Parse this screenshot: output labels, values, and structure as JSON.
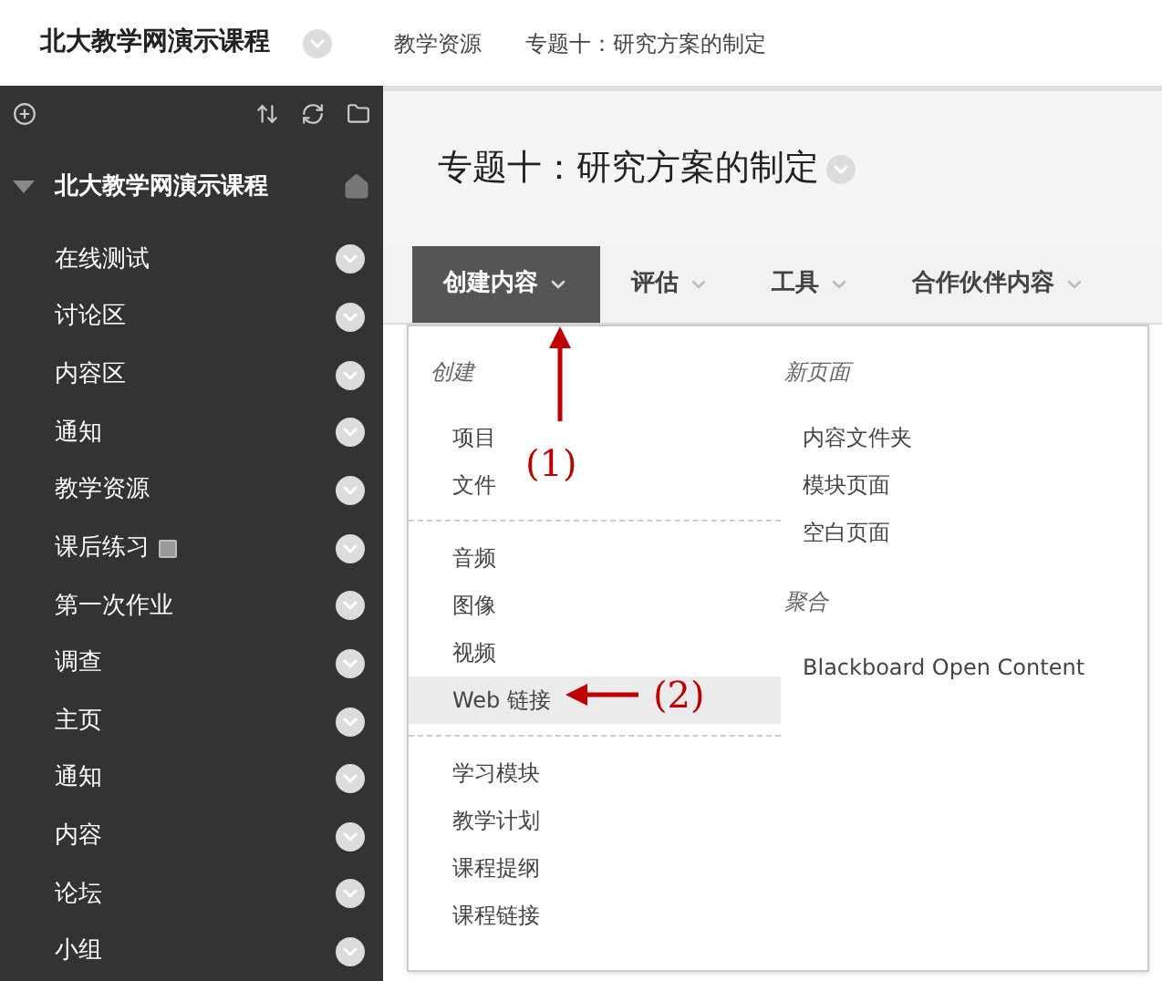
{
  "top_bar": {
    "course_title": "北大教学网演示课程",
    "breadcrumbs": [
      "教学资源",
      "专题十：研究方案的制定"
    ]
  },
  "sidebar": {
    "course_title": "北大教学网演示课程",
    "items": [
      {
        "label": "在线测试",
        "unavailable": false
      },
      {
        "label": "讨论区",
        "unavailable": false
      },
      {
        "label": "内容区",
        "unavailable": false
      },
      {
        "label": "通知",
        "unavailable": false
      },
      {
        "label": "教学资源",
        "unavailable": false
      },
      {
        "label": "课后练习",
        "unavailable": true
      },
      {
        "label": "第一次作业",
        "unavailable": false
      },
      {
        "label": "调查",
        "unavailable": false
      },
      {
        "label": "主页",
        "unavailable": false
      },
      {
        "label": "通知",
        "unavailable": false
      },
      {
        "label": "内容",
        "unavailable": false
      },
      {
        "label": "论坛",
        "unavailable": false
      },
      {
        "label": "小组",
        "unavailable": false
      }
    ]
  },
  "page_title": "专题十：研究方案的制定",
  "tabs": [
    {
      "label": "创建内容",
      "selected": true
    },
    {
      "label": "评估",
      "selected": false
    },
    {
      "label": "工具",
      "selected": false
    },
    {
      "label": "合作伙伴内容",
      "selected": false
    }
  ],
  "menu": {
    "left_groups": [
      {
        "heading": "创建",
        "items": [
          {
            "label": "项目",
            "selected": false
          },
          {
            "label": "文件",
            "selected": false
          }
        ]
      },
      {
        "items": [
          {
            "label": "音频",
            "selected": false
          },
          {
            "label": "图像",
            "selected": false
          },
          {
            "label": "视频",
            "selected": false
          },
          {
            "label": "Web 链接",
            "selected": true
          }
        ]
      },
      {
        "items": [
          {
            "label": "学习模块",
            "selected": false
          },
          {
            "label": "教学计划",
            "selected": false
          },
          {
            "label": "课程提纲",
            "selected": false
          },
          {
            "label": "课程链接",
            "selected": false
          }
        ]
      }
    ],
    "right_groups": [
      {
        "heading": "新页面",
        "items": [
          {
            "label": "内容文件夹",
            "selected": false
          },
          {
            "label": "模块页面",
            "selected": false
          },
          {
            "label": "空白页面",
            "selected": false
          }
        ]
      },
      {
        "heading": "聚合",
        "items": [
          {
            "label": "Blackboard Open Content",
            "selected": false
          }
        ]
      }
    ]
  },
  "annotations": [
    {
      "label": "(1)"
    },
    {
      "label": "(2)"
    }
  ]
}
